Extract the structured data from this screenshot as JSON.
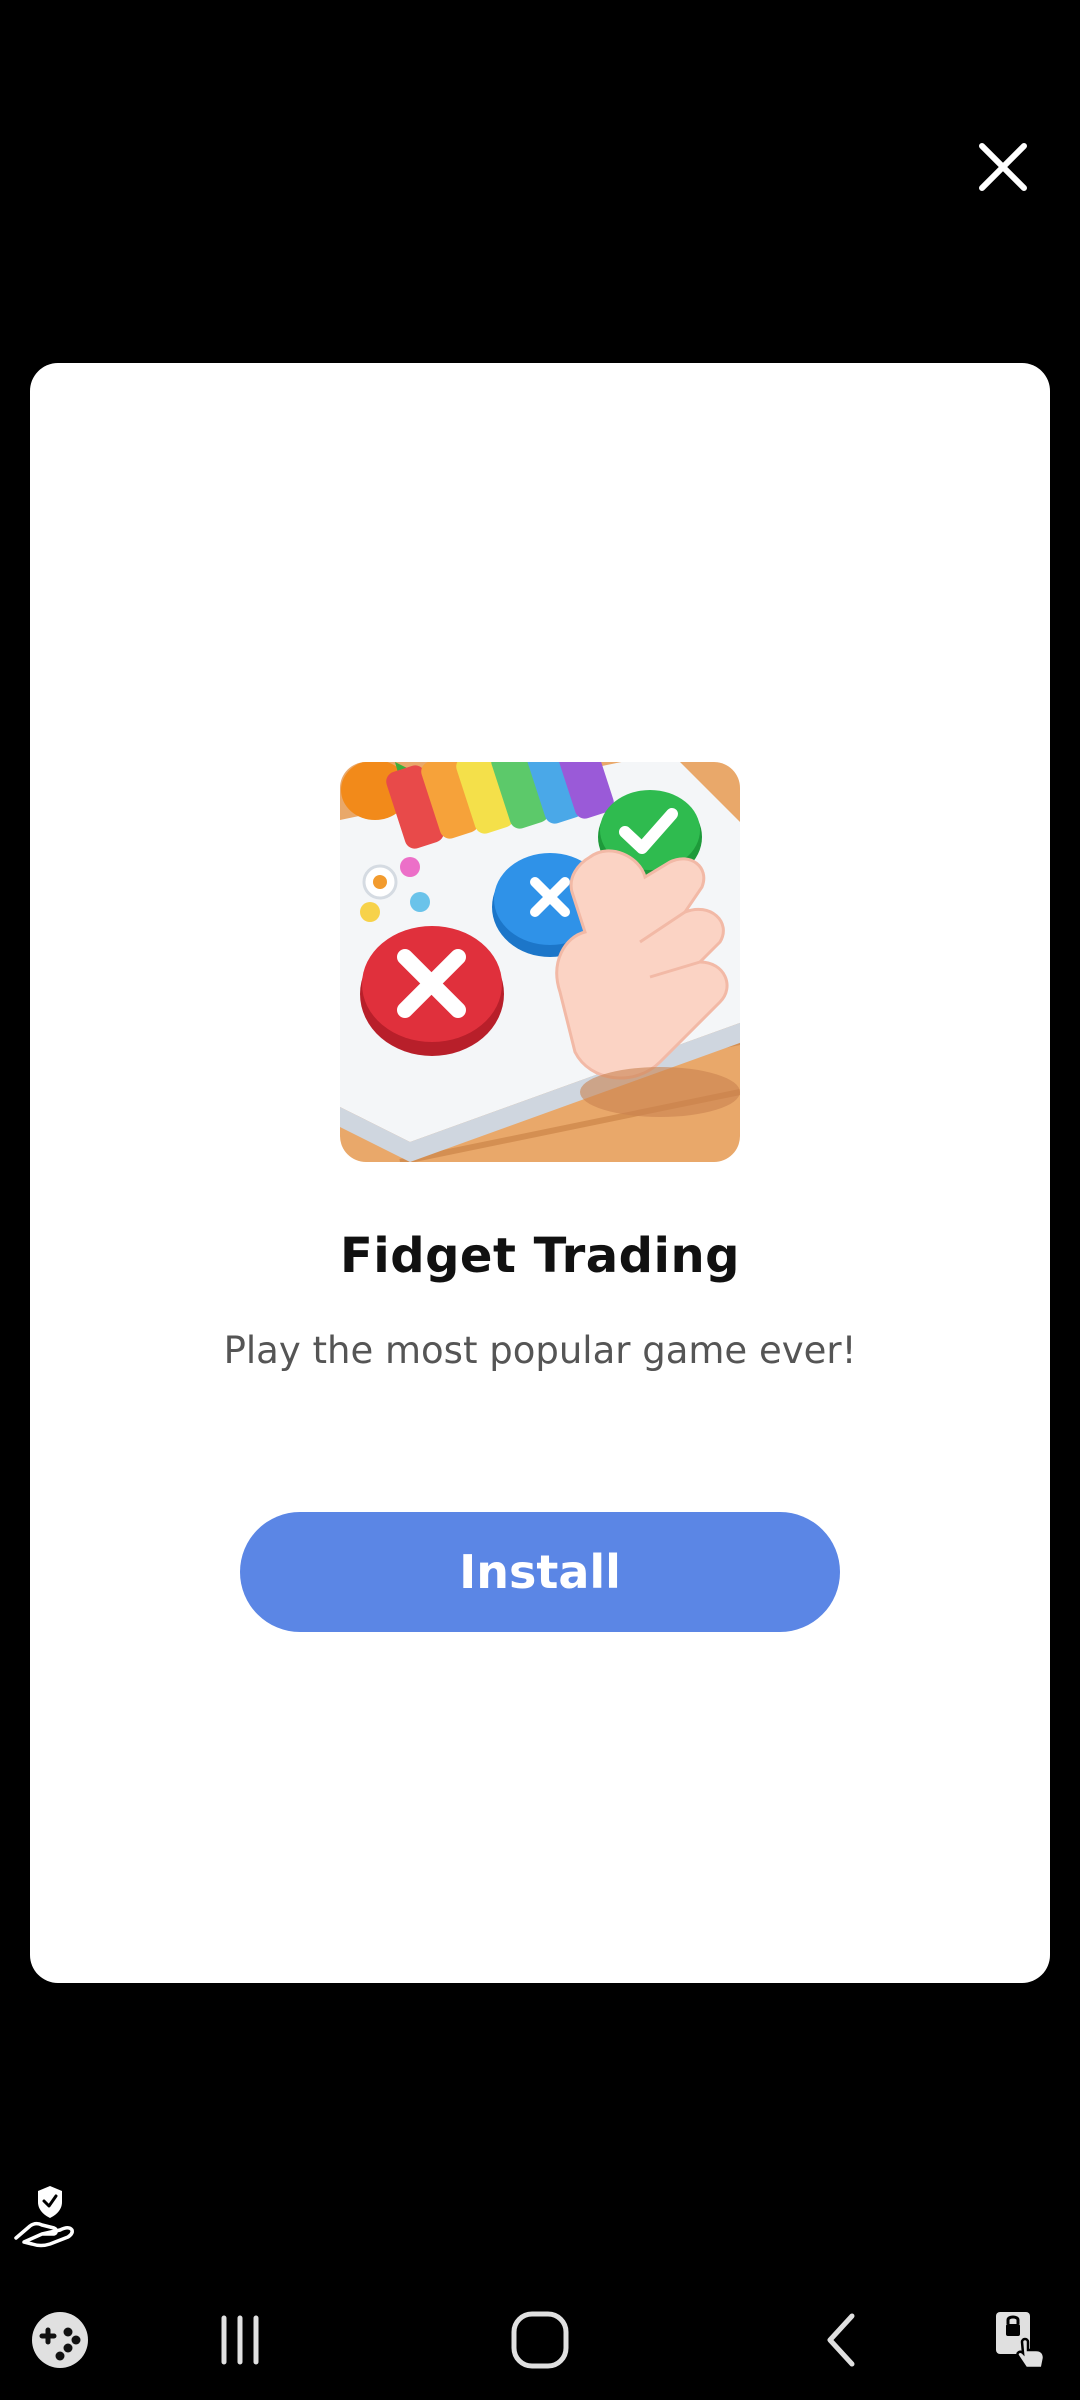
{
  "ad": {
    "app_name": "Fidget Trading",
    "tagline": "Play the most popular game ever!",
    "install_label": "Install"
  },
  "icons": {
    "close": "close-icon",
    "app_icon": "fidget-trading-app-icon",
    "privacy": "ad-choices-hand-shield-icon",
    "game_launcher": "game-launcher-icon",
    "recents": "recent-apps-icon",
    "home": "home-icon",
    "back": "back-icon",
    "accessibility": "screen-lock-touch-icon"
  },
  "colors": {
    "background": "#000000",
    "card": "#ffffff",
    "install_button": "#5b86e5",
    "title": "#111111",
    "tagline": "#555555"
  }
}
